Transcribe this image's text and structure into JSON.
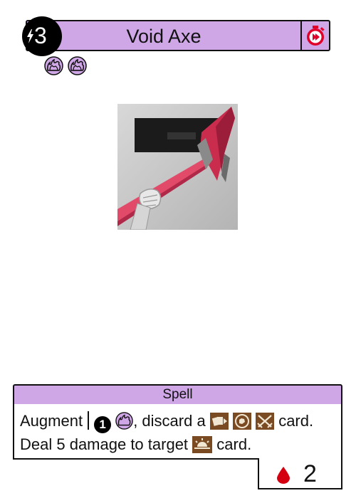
{
  "card": {
    "cost": "3",
    "name": "Void Axe",
    "type": "Spell",
    "text_line1_prefix": "Augment",
    "text_line1_number": "1",
    "text_line1_mid": ", discard a",
    "text_line1_suffix": "card.",
    "text_line2_prefix": "Deal 5 damage to target",
    "text_line2_suffix": "card.",
    "resource_value": "2"
  },
  "colors": {
    "title_bar": "#cfa6e6",
    "icon_red": "#e0002a",
    "blood_red": "#d40012",
    "keyword_brown": "#7a4a23"
  },
  "icons": {
    "cost": "lightning-bolt-icon",
    "timing": "stopwatch-icon",
    "void": "void-token-icon",
    "card_types": [
      "cards-icon",
      "fist-icon",
      "crossed-swords-icon"
    ],
    "target": "sunrise-icon",
    "resource": "blood-drop-icon"
  }
}
